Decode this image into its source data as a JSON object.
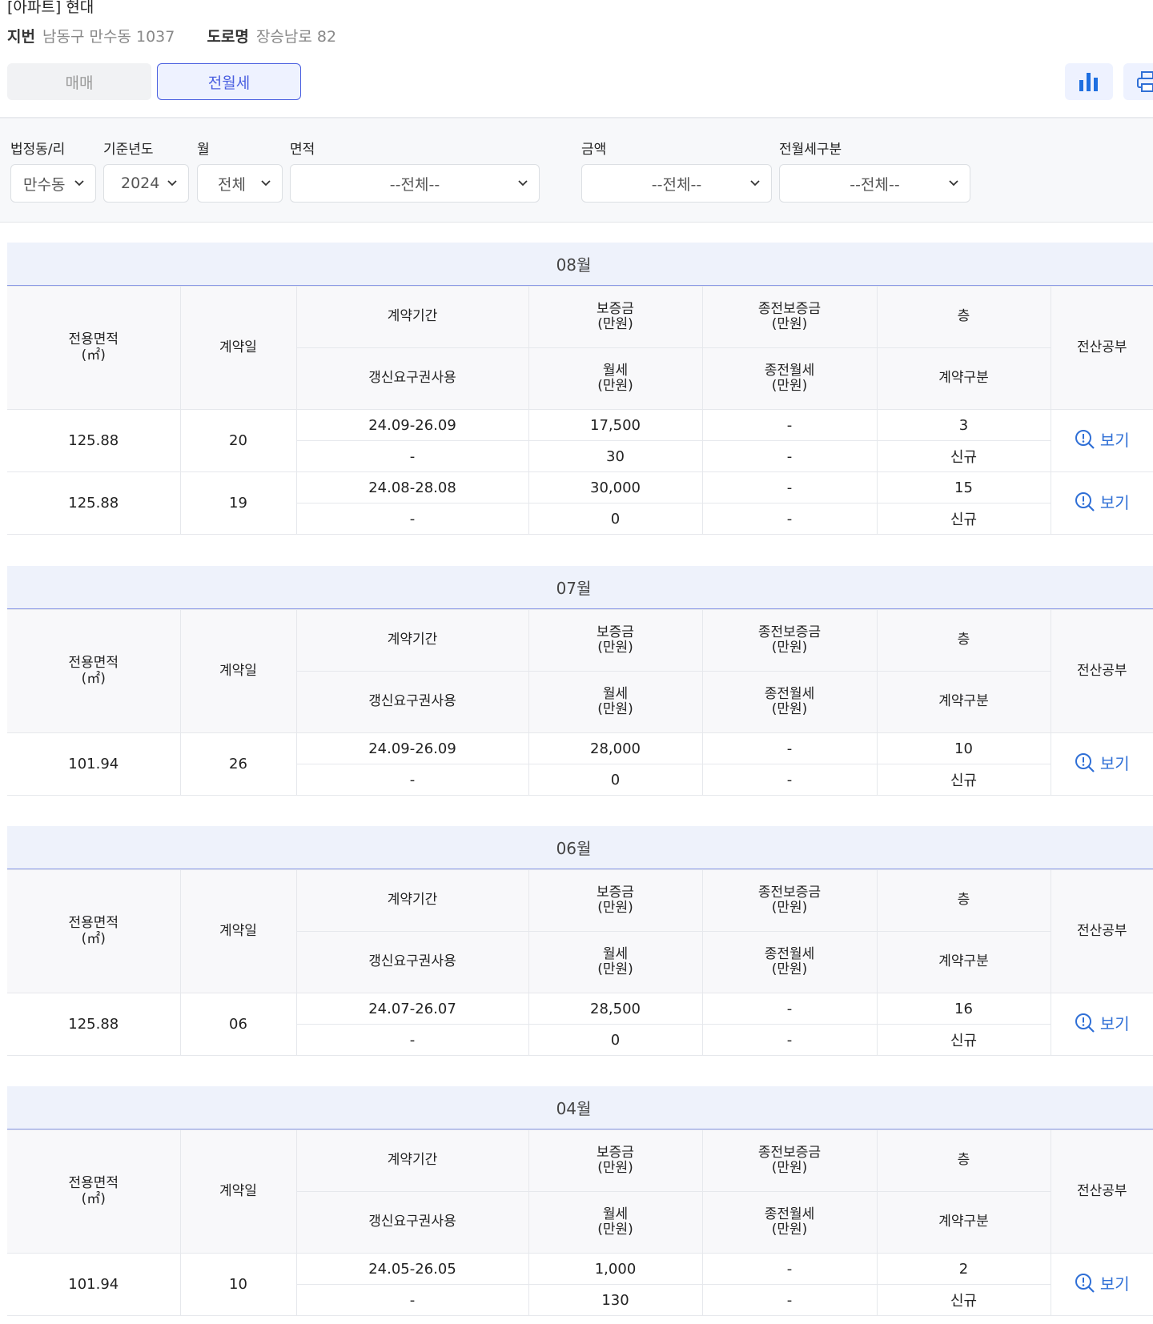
{
  "header": {
    "title": "[아파트] 현대",
    "jibun_label": "지번",
    "jibun_value": "남동구 만수동 1037",
    "road_label": "도로명",
    "road_value": "장승남로 82",
    "tabs": {
      "sale": "매매",
      "rent": "전월세"
    },
    "chart_icon": "bar-chart-icon",
    "print_icon": "print-icon"
  },
  "filters": {
    "dong_label": "법정동/리",
    "dong_value": "만수동",
    "year_label": "기준년도",
    "year_value": "2024",
    "month_label": "월",
    "month_value": "전체",
    "area_label": "면적",
    "area_value": "--전체--",
    "price_label": "금액",
    "price_value": "--전체--",
    "type_label": "전월세구분",
    "type_value": "--전체--"
  },
  "columns": {
    "area": "전용면적",
    "area_unit": "(㎡)",
    "contract_day": "계약일",
    "period": "계약기간",
    "deposit": "보증금",
    "deposit_unit": "(만원)",
    "prev_deposit": "종전보증금",
    "prev_deposit_unit": "(만원)",
    "floor": "층",
    "registry": "전산공부",
    "renewal": "갱신요구권사용",
    "monthly": "월세",
    "monthly_unit": "(만원)",
    "prev_monthly": "종전월세",
    "prev_monthly_unit": "(만원)",
    "contract_type": "계약구분"
  },
  "view_label": "보기",
  "months": [
    {
      "title": "08월",
      "rows": [
        {
          "area": "125.88",
          "day": "20",
          "period": "24.09-26.09",
          "deposit": "17,500",
          "prev_deposit": "-",
          "floor": "3",
          "renewal": "-",
          "monthly": "30",
          "prev_monthly": "-",
          "ctype": "신규"
        },
        {
          "area": "125.88",
          "day": "19",
          "period": "24.08-28.08",
          "deposit": "30,000",
          "prev_deposit": "-",
          "floor": "15",
          "renewal": "-",
          "monthly": "0",
          "prev_monthly": "-",
          "ctype": "신규"
        }
      ]
    },
    {
      "title": "07월",
      "rows": [
        {
          "area": "101.94",
          "day": "26",
          "period": "24.09-26.09",
          "deposit": "28,000",
          "prev_deposit": "-",
          "floor": "10",
          "renewal": "-",
          "monthly": "0",
          "prev_monthly": "-",
          "ctype": "신규"
        }
      ]
    },
    {
      "title": "06월",
      "rows": [
        {
          "area": "125.88",
          "day": "06",
          "period": "24.07-26.07",
          "deposit": "28,500",
          "prev_deposit": "-",
          "floor": "16",
          "renewal": "-",
          "monthly": "0",
          "prev_monthly": "-",
          "ctype": "신규"
        }
      ]
    },
    {
      "title": "04월",
      "rows": [
        {
          "area": "101.94",
          "day": "10",
          "period": "24.05-26.05",
          "deposit": "1,000",
          "prev_deposit": "-",
          "floor": "2",
          "renewal": "-",
          "monthly": "130",
          "prev_monthly": "-",
          "ctype": "신규"
        }
      ]
    }
  ]
}
